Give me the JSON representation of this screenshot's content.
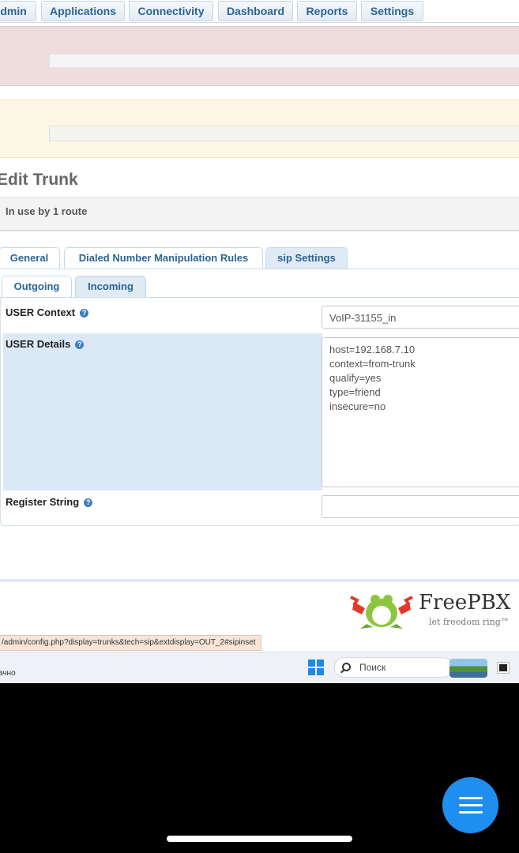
{
  "nav": {
    "items": [
      "Admin",
      "Applications",
      "Connectivity",
      "Dashboard",
      "Reports",
      "Settings"
    ]
  },
  "page": {
    "title": "Edit Trunk",
    "in_use": "In use by 1 route"
  },
  "tabs": {
    "main": [
      "General",
      "Dialed Number Manipulation Rules",
      "sip Settings"
    ],
    "active_main": "sip Settings",
    "sub": [
      "Outgoing",
      "Incoming"
    ],
    "active_sub": "Incoming"
  },
  "form": {
    "user_context_label": "USER Context",
    "user_context_value": "VoIP-31155_in",
    "user_details_label": "USER Details",
    "user_details_value": "host=192.168.7.10\ncontext=from-trunk\nqualify=yes\ntype=friend\ninsecure=no",
    "register_string_label": "Register String",
    "register_string_value": "",
    "help_glyph": "?"
  },
  "footer": {
    "brand": "FreePBX",
    "tagline": "let freedom ring™"
  },
  "status_url": "/admin/config.php?display=trunks&tech=sip&extdisplay=OUT_2#sipinset",
  "taskbar": {
    "left_text": "ачно",
    "search_placeholder": "Поиск"
  },
  "colors": {
    "link_blue": "#2a6496",
    "active_tab": "#dfeaf4",
    "alert_red": "#efdcdc",
    "alert_yellow": "#fcf7e4",
    "fab": "#1f8ef1"
  }
}
